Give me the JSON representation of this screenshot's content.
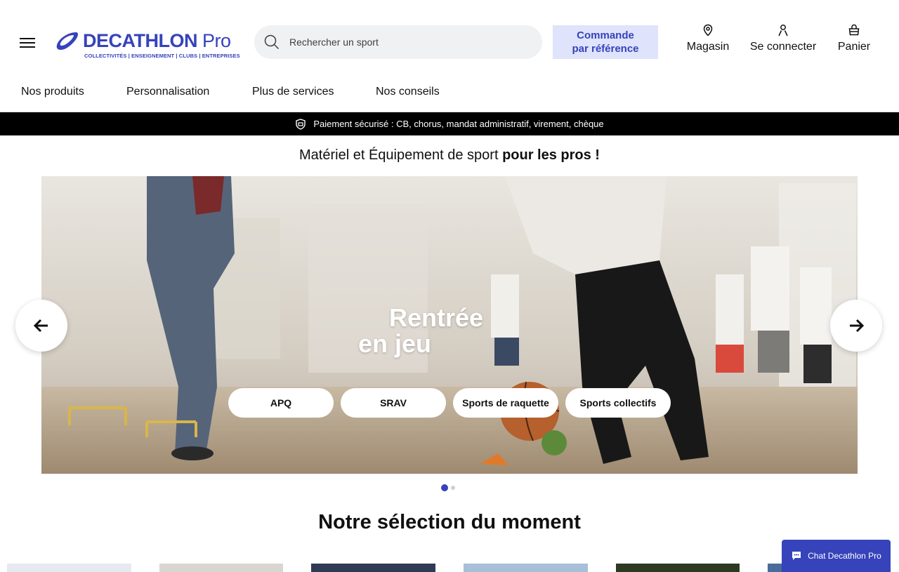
{
  "header": {
    "logo": {
      "brand": "DECATHLON",
      "suffix": "Pro",
      "tagline": "COLLECTIVITÉS | ENSEIGNEMENT | CLUBS | ENTREPRISES"
    },
    "search": {
      "placeholder": "Rechercher un sport"
    },
    "order_by_ref": {
      "line1": "Commande",
      "line2": "par référence"
    },
    "utilities": {
      "store": "Magasin",
      "login": "Se connecter",
      "cart": "Panier"
    },
    "nav": [
      "Nos produits",
      "Personnalisation",
      "Plus de services",
      "Nos conseils"
    ]
  },
  "payment_bar": {
    "text": "Paiement sécurisé : CB, chorus, mandat administratif, virement, chèque"
  },
  "tagline": {
    "regular": "Matériel et Équipement de sport ",
    "bold": "pour les pros !"
  },
  "hero": {
    "title_line1": "Rentrée",
    "title_line2": "en jeu",
    "pills": [
      "APQ",
      "SRAV",
      "Sports de raquette",
      "Sports collectifs"
    ],
    "slides": {
      "count": 2,
      "active": 1
    }
  },
  "selection": {
    "title": "Notre sélection du moment"
  },
  "chat": {
    "label": "Chat Decathlon Pro"
  },
  "colors": {
    "brand": "#3643ba",
    "pay_bar": "#000000",
    "order_btn_bg": "#dfe3fb",
    "dot_active": "#3643ba",
    "dot_inactive": "#cfd0d3"
  }
}
